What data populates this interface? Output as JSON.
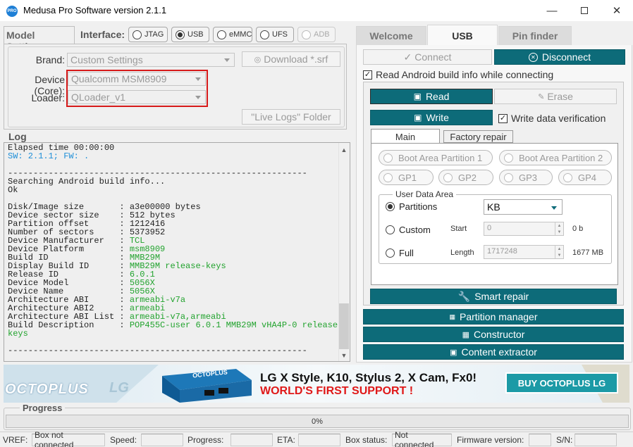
{
  "window": {
    "title": "Medusa Pro Software version 2.1.1",
    "app_icon_text": "PRO",
    "minimize_icon": "minimize-icon",
    "maximize_icon": "maximize-icon",
    "close_icon": "close-icon"
  },
  "left_tabs": {
    "model_settings": "Model Settings"
  },
  "interface": {
    "label": "Interface:",
    "options": [
      {
        "label": "JTAG",
        "selected": false,
        "enabled": true
      },
      {
        "label": "USB",
        "selected": true,
        "enabled": true
      },
      {
        "label": "eMMC",
        "selected": false,
        "enabled": true
      },
      {
        "label": "UFS",
        "selected": false,
        "enabled": true
      },
      {
        "label": "ADB",
        "selected": false,
        "enabled": false
      }
    ]
  },
  "model": {
    "brand_label": "Brand:",
    "brand_value": "Custom Settings",
    "device_label": "Device (Core):",
    "device_value": "Qualcomm MSM8909",
    "loader_label": "Loader:",
    "loader_value": "QLoader_v1",
    "download_button": "Download *.srf",
    "live_logs_button": "\"Live Logs\" Folder"
  },
  "log": {
    "title": "Log",
    "lines": [
      {
        "k": "Elapsed time 00:00:00",
        "v": "",
        "c": ""
      },
      {
        "k": "SW: 2.1.1; FW: .",
        "v": "",
        "c": "b"
      },
      {
        "k": "",
        "v": "",
        "c": ""
      },
      {
        "k": "-----------------------------------------------------------",
        "v": "",
        "c": ""
      },
      {
        "k": "Searching Android build info...",
        "v": "",
        "c": ""
      },
      {
        "k": "Ok",
        "v": "",
        "c": ""
      },
      {
        "k": "",
        "v": "",
        "c": ""
      },
      {
        "k": "Disk/Image size       : ",
        "v": "a3e00000 bytes",
        "c": ""
      },
      {
        "k": "Device sector size    : ",
        "v": "512 bytes",
        "c": ""
      },
      {
        "k": "Partition offset      : ",
        "v": "1212416",
        "c": ""
      },
      {
        "k": "Number of sectors     : ",
        "v": "5373952",
        "c": ""
      },
      {
        "k": "Device Manufacturer   : ",
        "v": "TCL",
        "c": "v"
      },
      {
        "k": "Device Platform       : ",
        "v": "msm8909",
        "c": "v"
      },
      {
        "k": "Build ID              : ",
        "v": "MMB29M",
        "c": "v"
      },
      {
        "k": "Display Build ID      : ",
        "v": "MMB29M release-keys",
        "c": "v"
      },
      {
        "k": "Release ID            : ",
        "v": "6.0.1",
        "c": "v"
      },
      {
        "k": "Device Model          : ",
        "v": "5056X",
        "c": "v"
      },
      {
        "k": "Device Name           : ",
        "v": "5056X",
        "c": "v"
      },
      {
        "k": "Architecture ABI      : ",
        "v": "armeabi-v7a",
        "c": "v"
      },
      {
        "k": "Architecture ABI2     : ",
        "v": "armeabi",
        "c": "v"
      },
      {
        "k": "Architecture ABI List : ",
        "v": "armeabi-v7a,armeabi",
        "c": "v"
      },
      {
        "k": "Build Description     : ",
        "v": "POP455C-user 6.0.1 MMB29M vHA4P-0 release-",
        "c": "v"
      },
      {
        "k": "",
        "v": "keys",
        "c": "v"
      },
      {
        "k": "",
        "v": "",
        "c": ""
      },
      {
        "k": "-----------------------------------------------------------",
        "v": "",
        "c": ""
      }
    ]
  },
  "right_tabs": {
    "welcome": "Welcome",
    "usb": "USB",
    "pin_finder": "Pin finder"
  },
  "usb": {
    "connect": "Connect",
    "disconnect": "Disconnect",
    "read_build_info": "Read Android build info while connecting",
    "read": "Read",
    "erase": "Erase",
    "write": "Write",
    "write_verify": "Write data verification",
    "subtabs": {
      "main": "Main",
      "factory_repair": "Factory repair"
    },
    "partitions": {
      "boot1": "Boot Area Partition 1",
      "boot2": "Boot Area Partition 2",
      "gp1": "GP1",
      "gp2": "GP2",
      "gp3": "GP3",
      "gp4": "GP4"
    },
    "user_data_area": {
      "title": "User Data Area",
      "partitions": "Partitions",
      "custom": "Custom",
      "full": "Full",
      "unit_value": "KB",
      "start_label": "Start",
      "start_value": "0",
      "start_unit": "0 b",
      "length_label": "Length",
      "length_value": "1717248",
      "length_unit": "1677 MB"
    },
    "smart_repair": "Smart repair",
    "partition_manager": "Partition manager",
    "constructor": "Constructor",
    "content_extractor": "Content extractor"
  },
  "banner": {
    "brand": "OCTOPLUS",
    "brand_suffix": "LG",
    "headline": "LG X Style, K10, Stylus 2, X Cam, Fx0!",
    "subline": "WORLD'S FIRST SUPPORT !",
    "cta": "BUY OCTOPLUS LG",
    "box_label": "OCTOPLUS"
  },
  "progress": {
    "title": "Progress",
    "text": "0%",
    "value": 0
  },
  "statusbar": {
    "vref_label": "VREF:",
    "vref_value": "Box not connected",
    "speed_label": "Speed:",
    "speed_value": "",
    "progress_label": "Progress:",
    "progress_value": "",
    "eta_label": "ETA:",
    "eta_value": "",
    "box_status_label": "Box status:",
    "box_status_value": "Not connected",
    "firmware_label": "Firmware version:",
    "firmware_value": "",
    "sn_label": "S/N:",
    "sn_value": ""
  },
  "colors": {
    "accent": "#0d6b79",
    "highlight": "#d61a1a",
    "log_value": "#22a32e",
    "log_info": "#1f8fd8"
  }
}
